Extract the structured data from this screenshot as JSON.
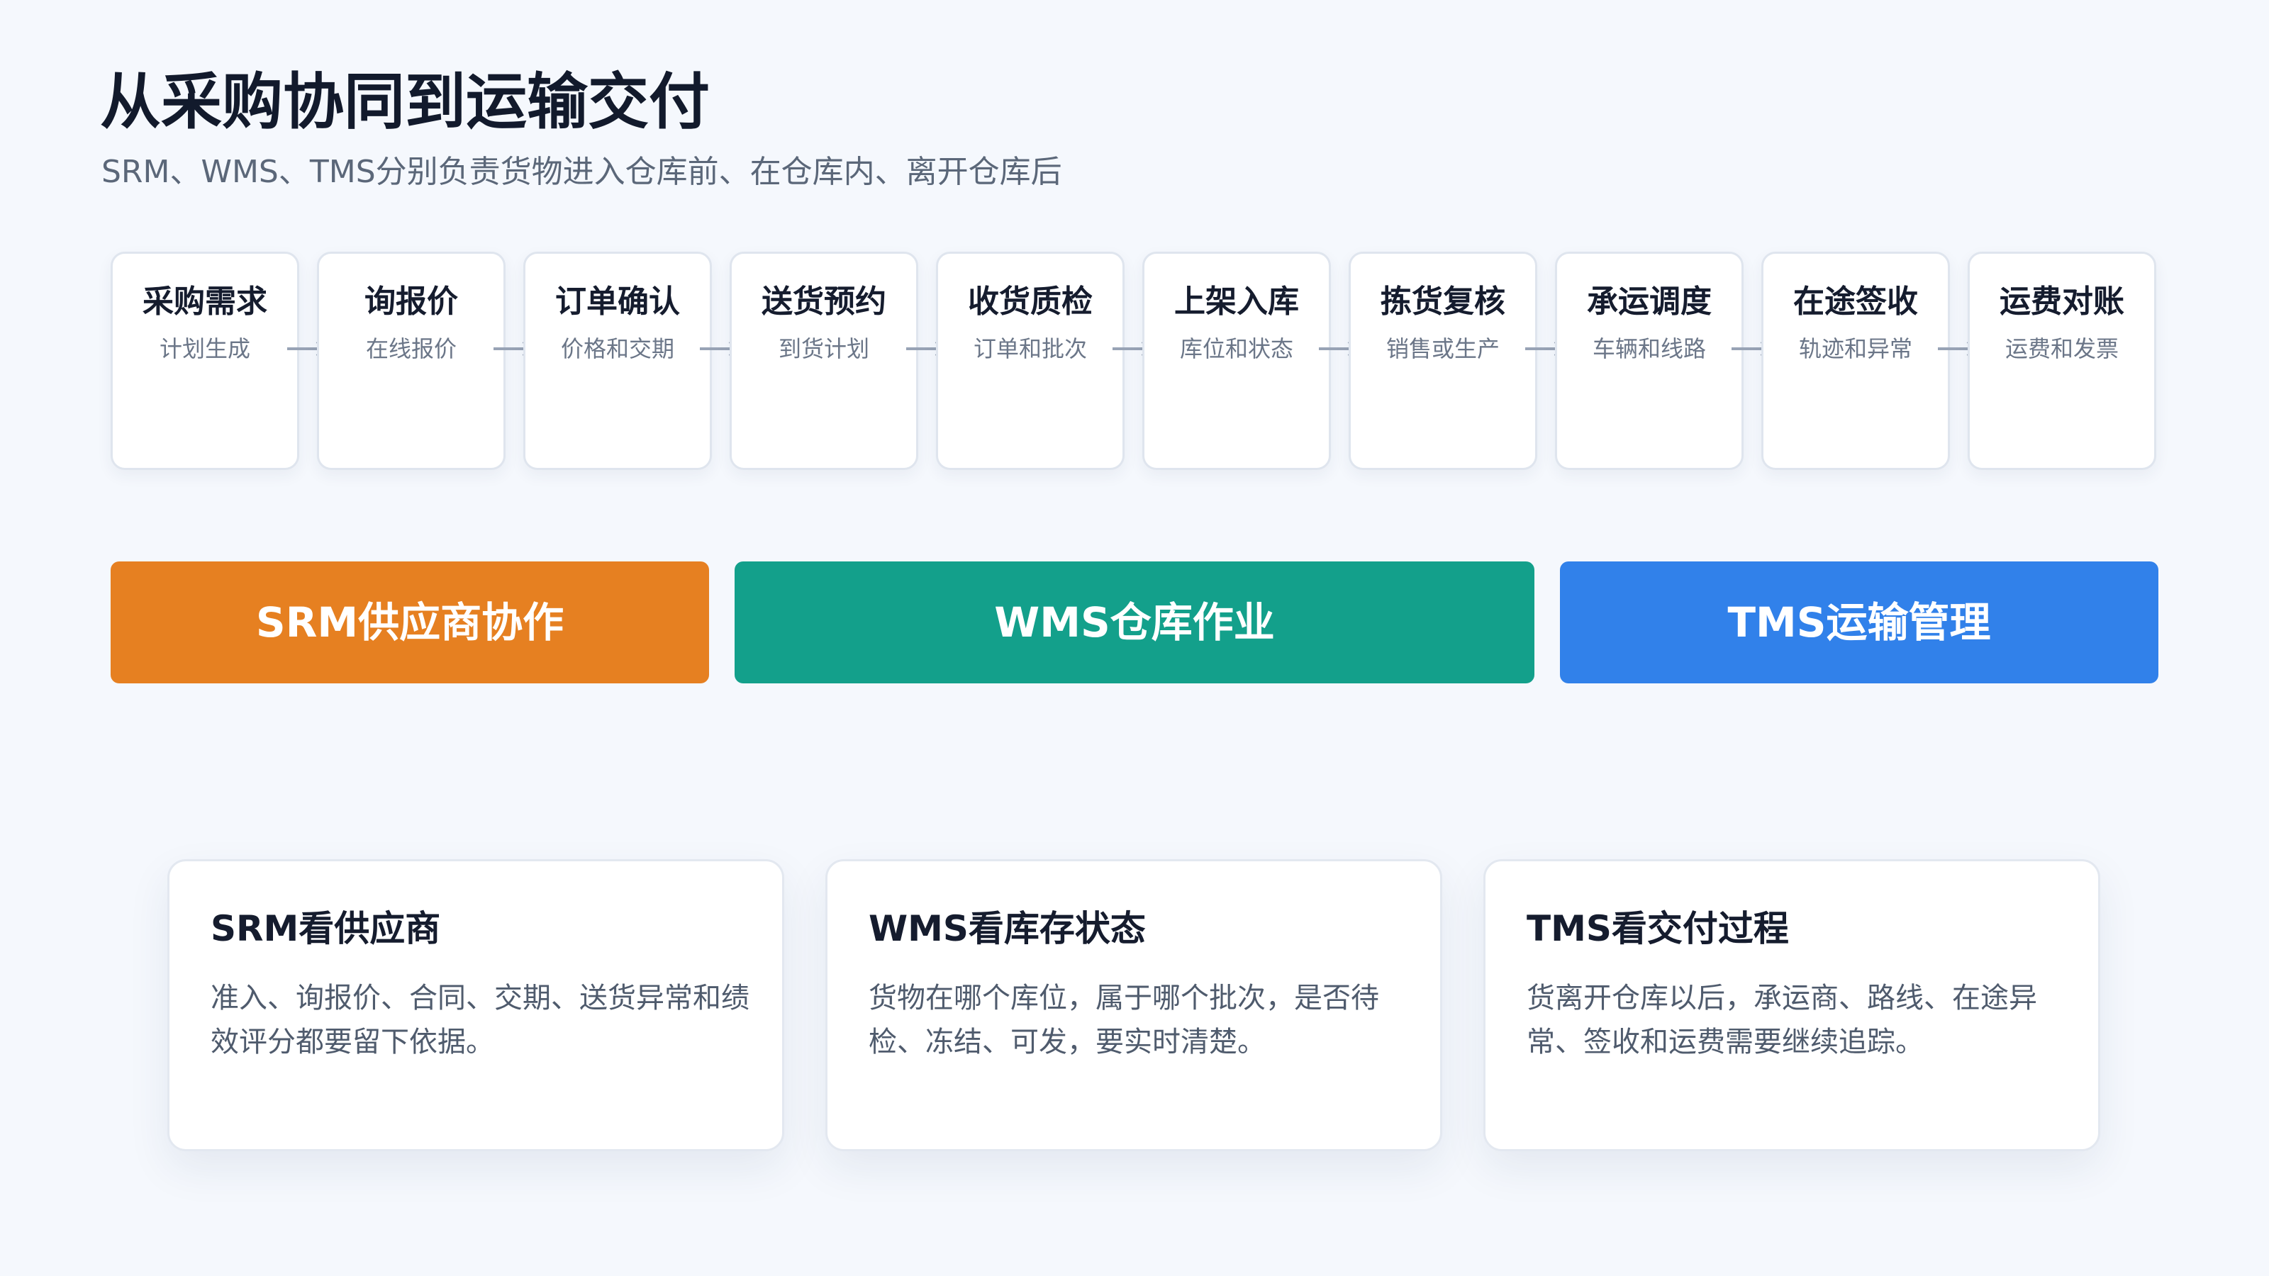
{
  "header": {
    "title": "从采购协同到运输交付",
    "subtitle": "SRM、WMS、TMS分别负责货物进入仓库前、在仓库内、离开仓库后"
  },
  "flow_steps": [
    {
      "title": "采购需求",
      "desc": "计划生成"
    },
    {
      "title": "询报价",
      "desc": "在线报价"
    },
    {
      "title": "订单确认",
      "desc": "价格和交期"
    },
    {
      "title": "送货预约",
      "desc": "到货计划"
    },
    {
      "title": "收货质检",
      "desc": "订单和批次"
    },
    {
      "title": "上架入库",
      "desc": "库位和状态"
    },
    {
      "title": "拣货复核",
      "desc": "销售或生产"
    },
    {
      "title": "承运调度",
      "desc": "车辆和线路"
    },
    {
      "title": "在途签收",
      "desc": "轨迹和异常"
    },
    {
      "title": "运费对账",
      "desc": "运费和发票"
    }
  ],
  "bands": [
    {
      "label": "SRM供应商协作",
      "color": "#e68021"
    },
    {
      "label": "WMS仓库作业",
      "color": "#13a08b"
    },
    {
      "label": "TMS运输管理",
      "color": "#3181ea"
    }
  ],
  "cards": [
    {
      "title": "SRM看供应商",
      "text": "准入、询报价、合同、交期、送货异常和绩效评分都要留下依据。"
    },
    {
      "title": "WMS看库存状态",
      "text": "货物在哪个库位，属于哪个批次，是否待检、冻结、可发，要实时清楚。"
    },
    {
      "title": "TMS看交付过程",
      "text": "货离开仓库以后，承运商、路线、在途异常、签收和运费需要继续追踪。"
    }
  ],
  "colors": {
    "arrow": "#98a3b5"
  }
}
